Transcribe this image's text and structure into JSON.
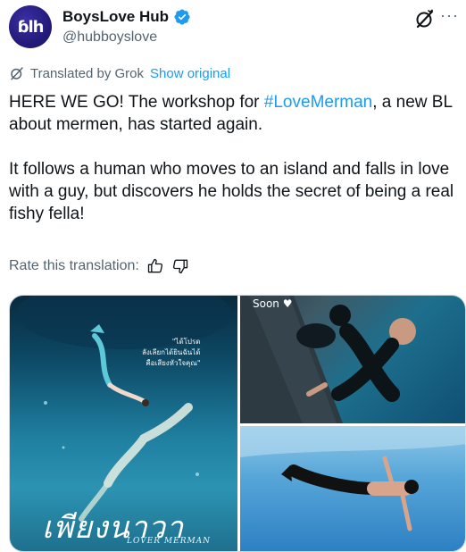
{
  "author": {
    "avatar_text": "ɓlh",
    "display_name": "BoysLove Hub",
    "handle": "@hubboyslove"
  },
  "translation": {
    "label": "Translated by Grok",
    "show_original": "Show original",
    "rate_label": "Rate this translation:"
  },
  "tweet": {
    "p1_before": "HERE WE GO! The workshop for ",
    "hashtag": "#LoveMerman",
    "p1_after": ", a new BL about mermen, has started again.",
    "p2": "It follows a human who moves to an island and falls in love with a guy, but discovers he holds the secret of being a real fishy fella!"
  },
  "media": {
    "poster_title": "เพียงนาวา",
    "poster_subtitle": "LOVER MERMAN",
    "poster_quote_1": "\"ได้โปรด",
    "poster_quote_2": "ลังเลียกได้ยินฉันได้",
    "poster_quote_3": "คือเสียงหัวใจคุณ\"",
    "soon_label": "Soon"
  },
  "colors": {
    "link": "#1d9bf0",
    "secondary_text": "#536471",
    "avatar_bg": "#241b7a"
  },
  "icons": [
    "verified-icon",
    "grok-icon",
    "more-icon",
    "translate-icon",
    "thumbs-up-icon",
    "thumbs-down-icon",
    "heart-icon"
  ]
}
